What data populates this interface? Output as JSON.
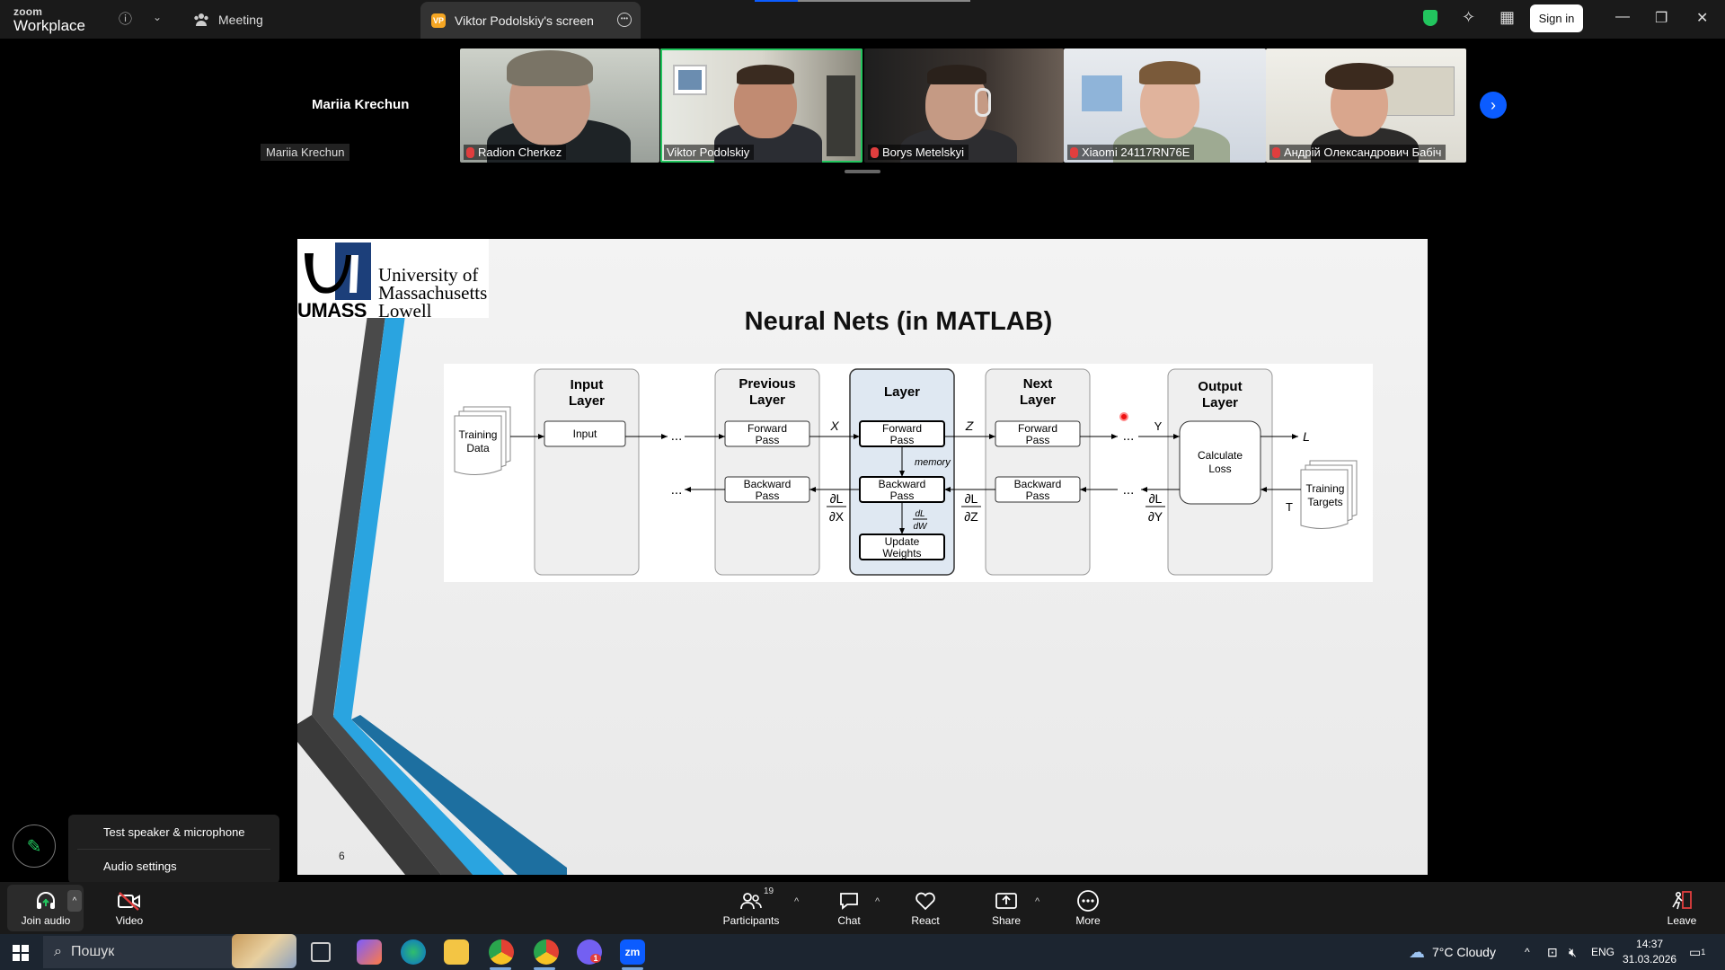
{
  "titlebar": {
    "logo_top": "zoom",
    "logo_bottom": "Workplace",
    "meeting_tab": "Meeting",
    "screen_tab_badge": "VP",
    "screen_tab_label": "Viktor Podolskiy's screen",
    "sign_in": "Sign in"
  },
  "gallery": {
    "self_name": "Mariia Krechun",
    "self_label": "Mariia Krechun",
    "tiles": [
      {
        "name": "Radion Cherkez",
        "muted": true
      },
      {
        "name": "Viktor Podolskiy",
        "muted": false,
        "active": true
      },
      {
        "name": "Borys Metelskyi",
        "muted": true
      },
      {
        "name": "Xiaomi 24117RN76E",
        "muted": true
      },
      {
        "name": "Андрій Олександрович Бабіч",
        "muted": true
      }
    ]
  },
  "slide": {
    "institution_mark": "UMASS",
    "institution_line1": "University of",
    "institution_line2": "Massachusetts",
    "institution_line3": "Lowell",
    "title": "Neural Nets (in MATLAB)",
    "page_number": "6",
    "diagram": {
      "training_data_l1": "Training",
      "training_data_l2": "Data",
      "input_layer_l1": "Input",
      "input_layer_l2": "Layer",
      "input_box": "Input",
      "prev_layer_l1": "Previous",
      "prev_layer_l2": "Layer",
      "layer": "Layer",
      "next_layer_l1": "Next",
      "next_layer_l2": "Layer",
      "output_layer_l1": "Output",
      "output_layer_l2": "Layer",
      "forward_l1": "Forward",
      "forward_l2": "Pass",
      "backward_l1": "Backward",
      "backward_l2": "Pass",
      "update_l1": "Update",
      "update_l2": "Weights",
      "calc_l1": "Calculate",
      "calc_l2": "Loss",
      "targets_l1": "Training",
      "targets_l2": "Targets",
      "memory": "memory",
      "ellipsis": "...",
      "var_x": "X",
      "var_z": "Z",
      "var_y": "Y",
      "var_l": "L",
      "var_t": "T",
      "dl": "∂L",
      "dx": "∂X",
      "dz": "∂Z",
      "dy": "∂Y",
      "dL_small": "dL",
      "dW_small": "dW"
    }
  },
  "audio_menu": {
    "item1": "Test speaker & microphone",
    "item2": "Audio settings"
  },
  "toolbar": {
    "join_audio": "Join audio",
    "video": "Video",
    "participants": "Participants",
    "participants_count": "19",
    "chat": "Chat",
    "react": "React",
    "share": "Share",
    "more": "More",
    "leave": "Leave"
  },
  "taskbar": {
    "search_placeholder": "Пошук",
    "weather": "7°C  Cloudy",
    "language": "ENG",
    "time": "14:37",
    "date": "31.03.2026",
    "notif_count": "1",
    "viber_badge": "1"
  }
}
